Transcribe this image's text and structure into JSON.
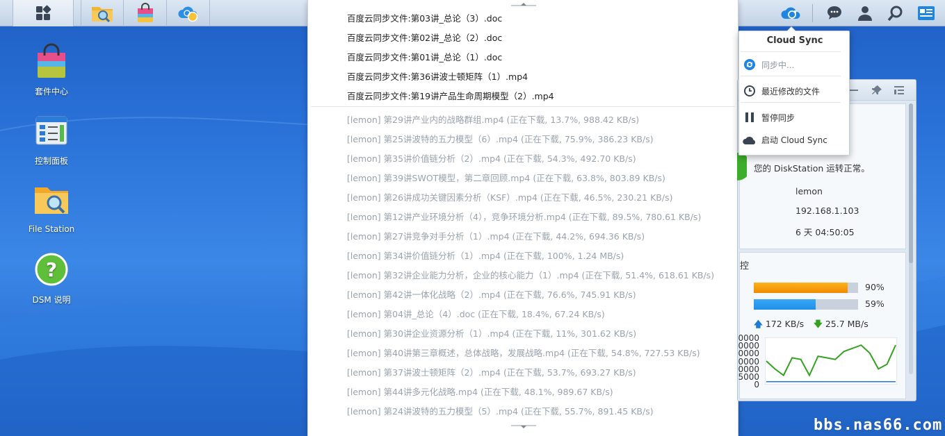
{
  "desktop": {
    "icons": [
      {
        "label": "套件中心"
      },
      {
        "label": "控制面板"
      },
      {
        "label": "File Station"
      },
      {
        "label": "DSM 说明"
      }
    ]
  },
  "notifications": {
    "completed": [
      "百度云同步文件:第03讲_总论（3）.doc",
      "百度云同步文件:第02讲_总论（2）.doc",
      "百度云同步文件:第01讲_总论（1）.doc",
      "百度云同步文件:第36讲波士顿矩阵（1）.mp4",
      "百度云同步文件:第19讲产品生命周期模型（2）.mp4"
    ],
    "in_progress": [
      "[lemon] 第29讲产业内的战略群组.mp4 (正在下载, 13.7%, 988.42 KB/s)",
      "[lemon] 第25讲波特的五力模型（6）.mp4 (正在下载, 75.9%, 386.23 KB/s)",
      "[lemon] 第35讲价值链分析（2）.mp4 (正在下载, 54.3%, 492.70 KB/s)",
      "[lemon] 第39讲SWOT模型，第二章回顾.mp4 (正在下载, 63.8%, 803.89 KB/s)",
      "[lemon] 第26讲成功关键因素分析（KSF）.mp4 (正在下载, 46.5%, 230.21 KB/s)",
      "[lemon] 第12讲产业环境分析（4），竞争环境分析.mp4 (正在下载, 89.5%, 780.61 KB/s)",
      "[lemon] 第27讲竞争对手分析（1）.mp4 (正在下载, 44.2%, 694.36 KB/s)",
      "[lemon] 第34讲价值链分析（1）.mp4 (正在下载, 100%, 1.24 MB/s)",
      "[lemon] 第32讲企业能力分析，企业的核心能力（1）.mp4 (正在下载, 51.4%, 618.61 KB/s)",
      "[lemon] 第42讲一体化战略（2）.mp4 (正在下载, 76.6%, 745.91 KB/s)",
      "[lemon] 第04讲_总论（4）.doc (正在下载, 18.4%, 67.24 KB/s)",
      "[lemon] 第30讲企业资源分析（1）.mp4 (正在下载, 11%, 301.62 KB/s)",
      "[lemon] 第40讲第三章概述，总体战略，发展战略.mp4 (正在下载, 54.8%, 727.53 KB/s)",
      "[lemon] 第37讲波士顿矩阵（2）.mp4 (正在下载, 53.7%, 693.27 KB/s)",
      "[lemon] 第44讲多元化战略.mp4 (正在下载, 48.1%, 989.67 KB/s)",
      "[lemon] 第24讲波特的五力模型（5）.mp4 (正在下载, 55.7%, 891.45 KB/s)"
    ]
  },
  "cloud_sync_menu": {
    "title": "Cloud Sync",
    "items": [
      {
        "label": "同步中...",
        "icon": "sync-spinning-icon"
      },
      {
        "label": "最近修改的文件",
        "icon": "clock-icon"
      },
      {
        "label": "暂停同步",
        "icon": "pause-icon"
      },
      {
        "label": "启动 Cloud Sync",
        "icon": "cloud-icon"
      }
    ]
  },
  "health_widget": {
    "status_text": "您的 DiskStation 运转正常。",
    "server_name": "lemon",
    "ip": "192.168.1.103",
    "uptime": "6 天 04:50:05"
  },
  "resource_widget": {
    "title_fragment": "控",
    "cpu_percent": 90,
    "cpu_label": "90%",
    "ram_percent": 59,
    "ram_label": "59%",
    "upload": "172 KB/s",
    "download": "25.7 MB/s",
    "colors": {
      "cpu": "#f08a00",
      "ram": "#1f8fe8",
      "upload_line": "#1c7ad6",
      "download_line": "#33a31f"
    }
  },
  "chart_data": {
    "type": "line",
    "y_ticks": [
      "0000",
      "0000",
      "0000",
      "0000",
      "0000",
      "5000",
      "0"
    ],
    "series": [
      {
        "values": [
          14,
          9,
          5,
          16,
          15,
          5,
          17,
          16,
          15,
          20,
          22,
          24,
          19,
          9,
          12,
          24
        ]
      },
      {
        "values": [
          1,
          1,
          1,
          1,
          1,
          1,
          1,
          1,
          1,
          1,
          1,
          1,
          1,
          1,
          1,
          1
        ]
      }
    ],
    "ylim": [
      0,
      28
    ]
  },
  "watermark": "bbs.nas66.com"
}
